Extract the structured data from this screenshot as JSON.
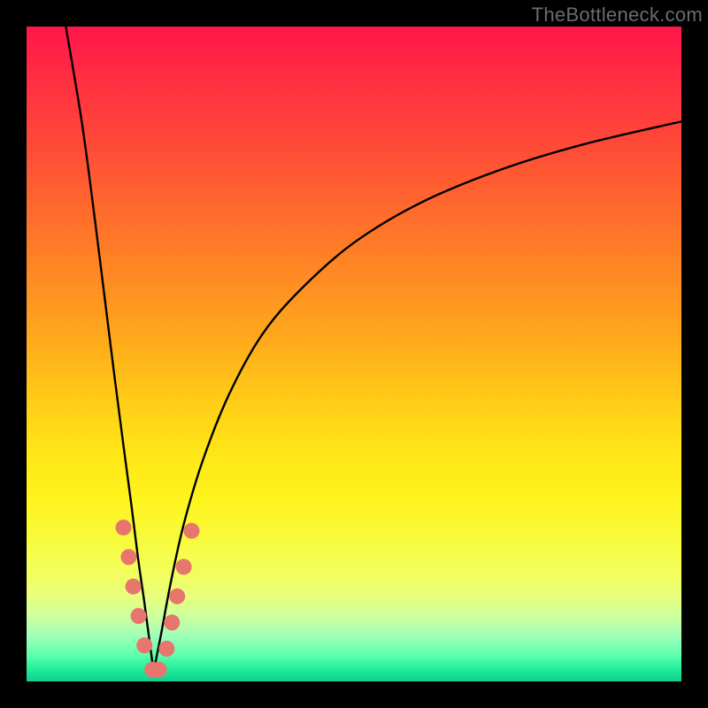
{
  "watermark": "TheBottleneck.com",
  "chart_data": {
    "type": "line",
    "title": "",
    "xlabel": "",
    "ylabel": "",
    "xlim": [
      0,
      100
    ],
    "ylim": [
      0,
      100
    ],
    "grid": false,
    "legend": false,
    "note": "Two black curves forming a sharp V near x≈19; right branch rises asymptotically toward ~85.",
    "series": [
      {
        "name": "left-branch",
        "x": [
          6.0,
          8.5,
          10.5,
          12.0,
          13.5,
          14.8,
          16.0,
          17.0,
          18.0,
          18.8,
          19.4
        ],
        "y": [
          100,
          85,
          70,
          58,
          46,
          36,
          27,
          19,
          12,
          6,
          1.5
        ]
      },
      {
        "name": "right-branch",
        "x": [
          19.4,
          20.5,
          22.0,
          24.0,
          27.0,
          31.0,
          36.0,
          42.0,
          50.0,
          60.0,
          72.0,
          85.0,
          100.0
        ],
        "y": [
          1.5,
          7,
          15,
          24,
          34,
          44,
          53,
          60,
          67,
          73,
          78,
          82,
          85.5
        ]
      }
    ],
    "markers": {
      "name": "highlight-dots",
      "color": "#e7766e",
      "radius_px": 9,
      "points": [
        {
          "x": 14.8,
          "y": 23.5
        },
        {
          "x": 15.6,
          "y": 19.0
        },
        {
          "x": 16.3,
          "y": 14.5
        },
        {
          "x": 17.1,
          "y": 10.0
        },
        {
          "x": 18.0,
          "y": 5.5
        },
        {
          "x": 19.2,
          "y": 1.8
        },
        {
          "x": 20.2,
          "y": 1.8
        },
        {
          "x": 21.4,
          "y": 5.0
        },
        {
          "x": 22.2,
          "y": 9.0
        },
        {
          "x": 23.0,
          "y": 13.0
        },
        {
          "x": 24.0,
          "y": 17.5
        },
        {
          "x": 25.2,
          "y": 23.0
        }
      ]
    }
  }
}
